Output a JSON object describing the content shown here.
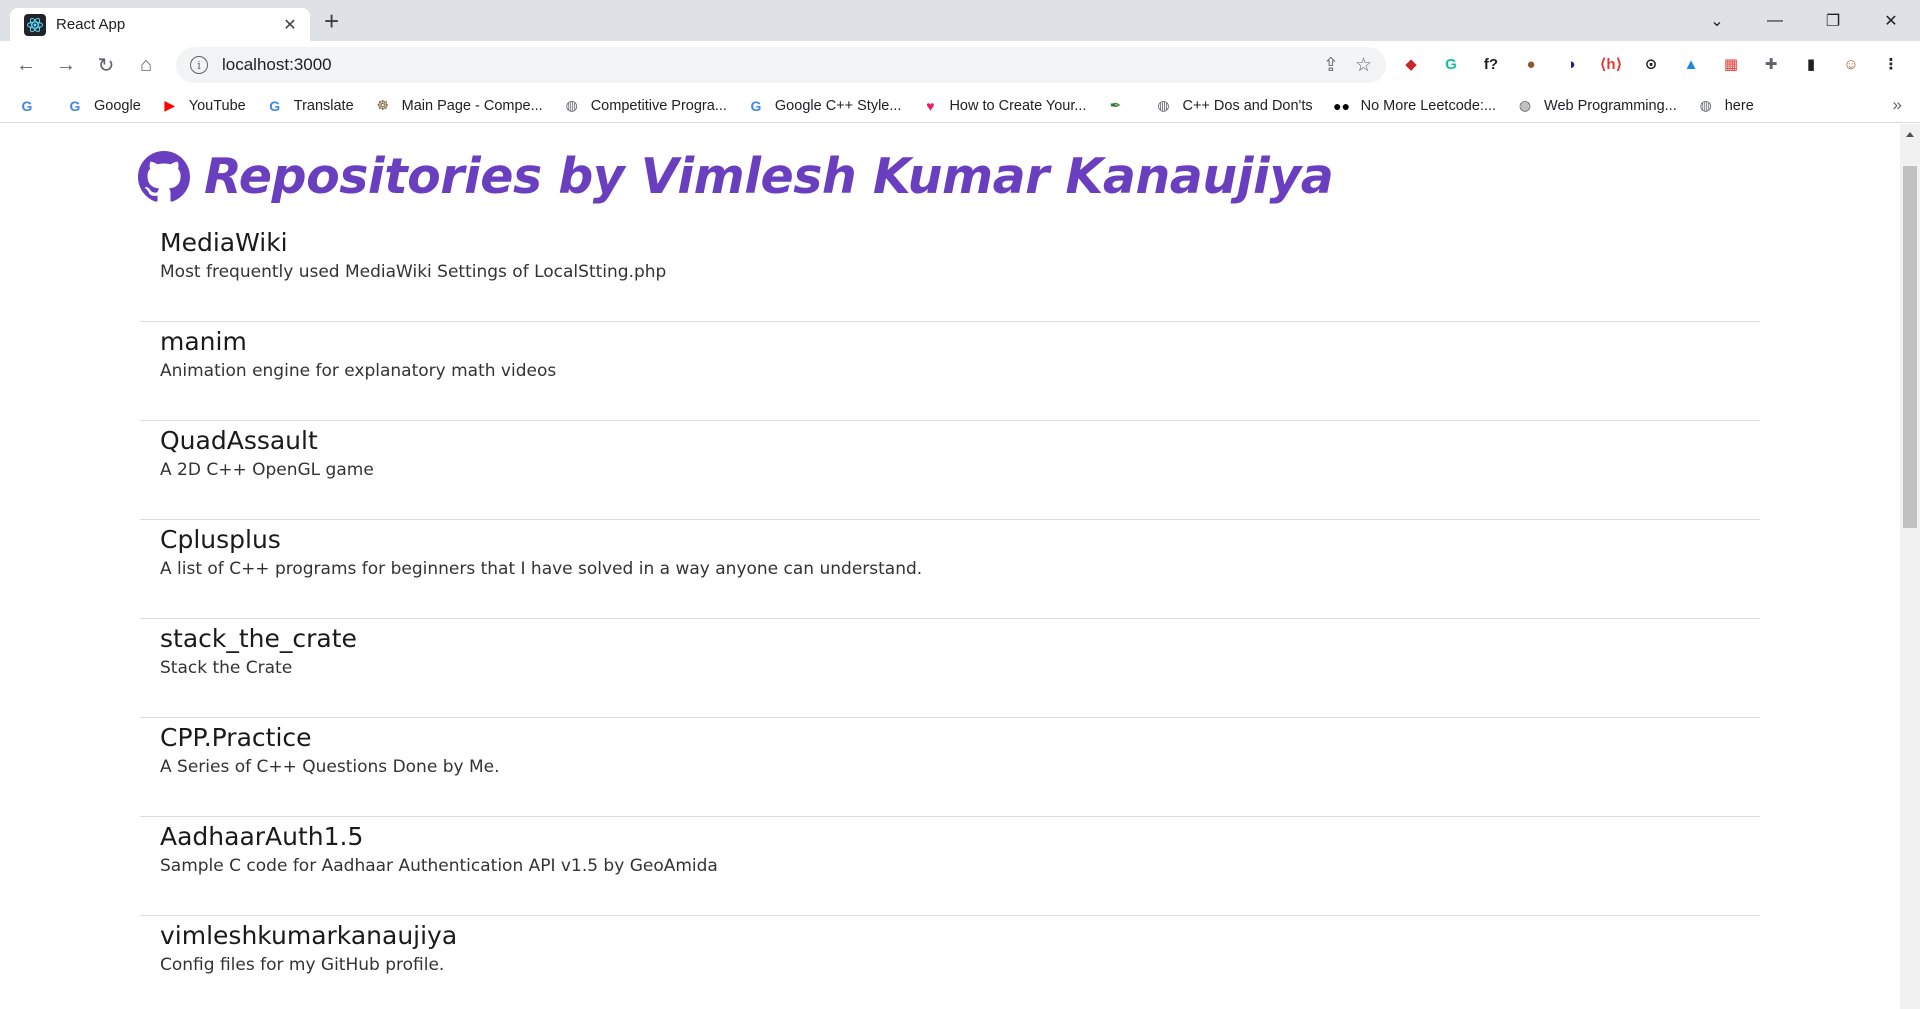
{
  "browser": {
    "tab_title": "React App",
    "tab_close": "✕",
    "new_tab": "+",
    "window_controls": [
      "⌄",
      "—",
      "❐",
      "✕"
    ],
    "url": "localhost:3000",
    "nav": {
      "back": "←",
      "forward": "→",
      "reload": "↻",
      "home": "⌂"
    },
    "omnibox_info": "i",
    "omnibox_icons": {
      "share": "⇪",
      "star": "☆"
    },
    "extensions": [
      {
        "icon": "ext-icon",
        "glyph": "◆",
        "color": "#c62828"
      },
      {
        "icon": "grammarly-icon",
        "glyph": "G",
        "color": "#15c39a"
      },
      {
        "icon": "function-icon",
        "glyph": "f?",
        "color": "#202124"
      },
      {
        "icon": "cookie-icon",
        "glyph": "●",
        "color": "#8d5a2b"
      },
      {
        "icon": "ext-icon",
        "glyph": "◑",
        "color": "#1a237e"
      },
      {
        "icon": "ext-icon",
        "glyph": "⟨h⟩",
        "color": "#e53935"
      },
      {
        "icon": "ext-icon",
        "glyph": "⊙",
        "color": "#202124"
      },
      {
        "icon": "ext-icon",
        "glyph": "▲",
        "color": "#1e88e5"
      },
      {
        "icon": "ext-icon",
        "glyph": "▦",
        "color": "#e53935"
      },
      {
        "icon": "puzzle-icon",
        "glyph": "✚",
        "color": "#5f6368"
      },
      {
        "icon": "sidepanel-icon",
        "glyph": "▮",
        "color": "#202124"
      },
      {
        "icon": "avatar",
        "glyph": "☺",
        "color": "#a0522d"
      },
      {
        "icon": "menu-icon",
        "glyph": "⋮",
        "color": "#202124"
      }
    ],
    "bookmarks": [
      {
        "label": "",
        "icon": "google-icon",
        "glyph": "G",
        "color": "#4285f4"
      },
      {
        "label": "Google",
        "icon": "google-icon",
        "glyph": "G",
        "color": "#4285f4"
      },
      {
        "label": "YouTube",
        "icon": "youtube-icon",
        "glyph": "▶",
        "color": "#ff0000"
      },
      {
        "label": "Translate",
        "icon": "translate-icon",
        "glyph": "G",
        "color": "#4285f4"
      },
      {
        "label": "Main Page - Compe...",
        "icon": "wiki-icon",
        "glyph": "☸",
        "color": "#7b5e3b"
      },
      {
        "label": "Competitive Progra...",
        "icon": "globe-icon",
        "glyph": "◍",
        "color": "#5f6368"
      },
      {
        "label": "Google C++ Style...",
        "icon": "google-icon",
        "glyph": "G",
        "color": "#4285f4"
      },
      {
        "label": "How to Create Your...",
        "icon": "heart-icon",
        "glyph": "♥",
        "color": "#e91e63"
      },
      {
        "label": "",
        "icon": "feather-icon",
        "glyph": "✒",
        "color": "#2e7d32"
      },
      {
        "label": "C++ Dos and Don'ts",
        "icon": "globe-icon",
        "glyph": "◍",
        "color": "#5f6368"
      },
      {
        "label": "No More Leetcode:...",
        "icon": "medium-icon",
        "glyph": "●●",
        "color": "#000000"
      },
      {
        "label": "Web Programming...",
        "icon": "globe-icon",
        "glyph": "◍",
        "color": "#5f6368"
      },
      {
        "label": "here",
        "icon": "globe-icon",
        "glyph": "◍",
        "color": "#5f6368"
      }
    ],
    "bookmarks_more": "»"
  },
  "page": {
    "title": "Repositories by Vimlesh Kumar Kanaujiya",
    "accent_color": "#6a3fbf",
    "repos": [
      {
        "name": "MediaWiki",
        "description": "Most frequently used MediaWiki Settings of LocalStting.php"
      },
      {
        "name": "manim",
        "description": "Animation engine for explanatory math videos"
      },
      {
        "name": "QuadAssault",
        "description": "A 2D C++ OpenGL game"
      },
      {
        "name": "Cplusplus",
        "description": "A list of C++ programs for beginners that I have solved in a way anyone can understand."
      },
      {
        "name": "stack_the_crate",
        "description": "Stack the Crate"
      },
      {
        "name": "CPP.Practice",
        "description": "A Series of C++ Questions Done by Me."
      },
      {
        "name": "AadhaarAuth1.5",
        "description": "Sample C code for Aadhaar Authentication API v1.5 by GeoAmida"
      },
      {
        "name": "vimleshkumarkanaujiya",
        "description": "Config files for my GitHub profile."
      }
    ]
  }
}
